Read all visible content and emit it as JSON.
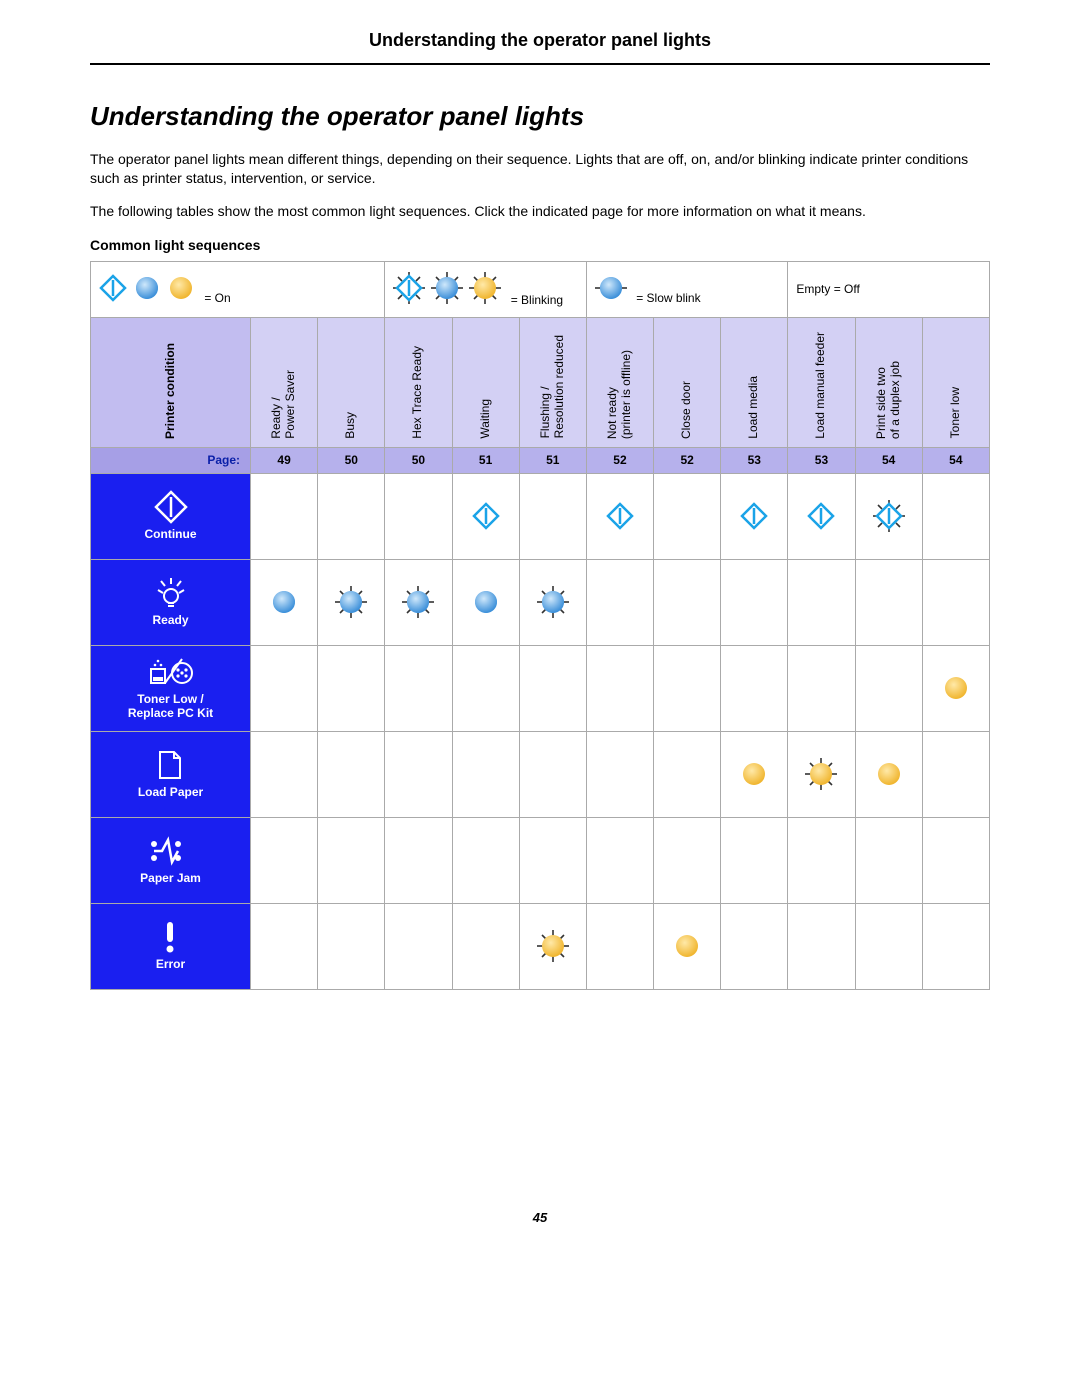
{
  "header": {
    "title": "Understanding the operator panel lights"
  },
  "main": {
    "title": "Understanding the operator panel lights",
    "p1": "The operator panel lights mean different things, depending on their sequence. Lights that are off, on, and/or blinking indicate printer conditions such as printer status, intervention, or service.",
    "p2": "The following tables show the most common light sequences. Click the indicated page for more information on what it means.",
    "caption": "Common light sequences"
  },
  "legend": {
    "on": "= On",
    "blinking": "= Blinking",
    "slow": "= Slow blink",
    "off": "Empty = Off"
  },
  "columns": {
    "condition_label": "Printer condition",
    "page_label": "Page:",
    "items": [
      {
        "label": "Ready /\nPower Saver",
        "page": "49"
      },
      {
        "label": "Busy",
        "page": "50"
      },
      {
        "label": "Hex Trace Ready",
        "page": "50"
      },
      {
        "label": "Waiting",
        "page": "51"
      },
      {
        "label": "Flushing /\nResolution reduced",
        "page": "51"
      },
      {
        "label": "Not ready\n(printer is offline)",
        "page": "52"
      },
      {
        "label": "Close door",
        "page": "52"
      },
      {
        "label": "Load media",
        "page": "53"
      },
      {
        "label": "Load manual feeder",
        "page": "53"
      },
      {
        "label": "Print side two\nof a duplex job",
        "page": "54"
      },
      {
        "label": "Toner low",
        "page": "54"
      }
    ]
  },
  "rows": [
    {
      "key": "continue",
      "label": "Continue",
      "icon": "continue"
    },
    {
      "key": "ready",
      "label": "Ready",
      "icon": "bulb"
    },
    {
      "key": "toner",
      "label": "Toner Low /\nReplace PC Kit",
      "icon": "toner"
    },
    {
      "key": "load",
      "label": "Load Paper",
      "icon": "page"
    },
    {
      "key": "jam",
      "label": "Paper Jam",
      "icon": "jam"
    },
    {
      "key": "error",
      "label": "Error",
      "icon": "excl"
    }
  ],
  "states": {
    "continue": [
      "",
      "",
      "",
      "diamond-on",
      "",
      "diamond-on",
      "",
      "diamond-on",
      "diamond-on",
      "diamond-blink",
      ""
    ],
    "ready": [
      "blue-on",
      "blue-blink",
      "blue-blink",
      "blue-on",
      "blue-blink",
      "",
      "",
      "",
      "",
      "",
      ""
    ],
    "toner": [
      "",
      "",
      "",
      "",
      "",
      "",
      "",
      "",
      "",
      "",
      "amber-on"
    ],
    "load": [
      "",
      "",
      "",
      "",
      "",
      "",
      "",
      "amber-on",
      "amber-blink",
      "amber-on",
      ""
    ],
    "jam": [
      "",
      "",
      "",
      "",
      "",
      "",
      "",
      "",
      "",
      "",
      ""
    ],
    "error": [
      "",
      "",
      "",
      "",
      "amber-blink",
      "",
      "amber-on",
      "",
      "",
      "",
      ""
    ]
  },
  "footer": {
    "page": "45"
  }
}
